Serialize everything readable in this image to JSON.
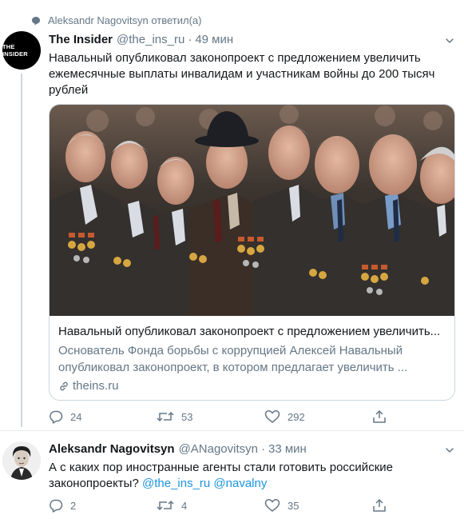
{
  "context": {
    "replied_text": "Aleksandr Nagovitsyn ответил(а)"
  },
  "tweet1": {
    "avatar_text": "THE INSIDER",
    "name": "The Insider",
    "handle": "@the_ins_ru",
    "dot": "·",
    "time": "49 мин",
    "text": "Навальный опубликовал законопроект с предложением увеличить ежемесячные выплаты инвалидам и участникам войны до 200 тысяч рублей",
    "card": {
      "title": "Навальный опубликовал законопроект с предложением увеличить...",
      "description": "Основатель Фонда борьбы с коррупцией Алексей Навальный опубликовал законопроект, в котором предлагает увеличить ...",
      "domain": "theins.ru"
    },
    "actions": {
      "replies": "24",
      "retweets": "53",
      "likes": "292"
    }
  },
  "tweet2": {
    "name": "Aleksandr Nagovitsyn",
    "handle": "@ANagovitsyn",
    "dot": "·",
    "time": "33 мин",
    "text_main": "А с каких пор иностранные агенты стали готовить российские законопроекты?",
    "mention1": "@the_ins_ru",
    "mention2": "@navalny",
    "actions": {
      "replies": "2",
      "retweets": "4",
      "likes": "35"
    }
  },
  "colors": {
    "text": "#14171a",
    "secondary": "#657786",
    "link": "#1b95e0",
    "border": "#ccd6dd"
  }
}
